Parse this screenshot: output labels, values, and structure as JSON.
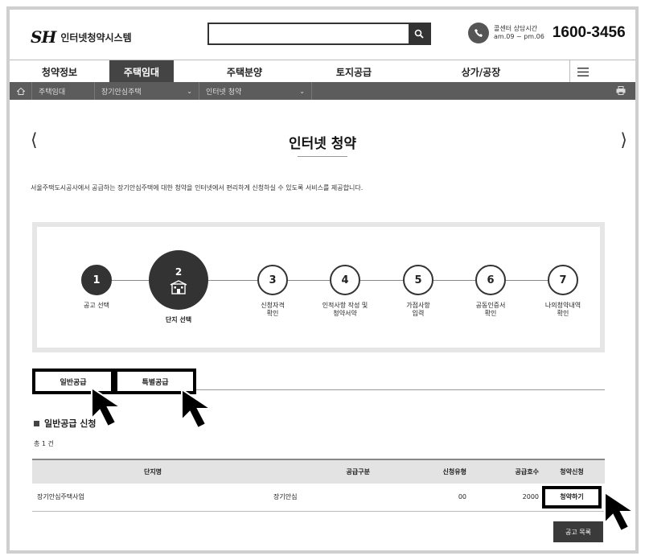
{
  "header": {
    "logo_mark": "SH",
    "logo_text": "인터넷청약시스템",
    "search": {
      "value": "",
      "placeholder": ""
    },
    "callcenter": {
      "label": "콜센터 상담시간",
      "hours": "am.09 ~ pm.06",
      "number": "1600-3456"
    }
  },
  "nav": {
    "items": [
      {
        "label": "청약정보"
      },
      {
        "label": "주택임대"
      },
      {
        "label": "주택분양"
      },
      {
        "label": "토지공급"
      },
      {
        "label": "상가/공장"
      }
    ],
    "active_index": 1
  },
  "breadcrumb": {
    "items": [
      "주택임대",
      "장기안심주택",
      "인터넷 청약"
    ]
  },
  "page": {
    "title": "인터넷 청약",
    "intro": "서울주택도시공사에서 공급하는 장기안심주택에 대한 청약을 인터넷에서 편리하게 신청하실 수 있도록 서비스를 제공합니다."
  },
  "steps": [
    {
      "num": "1",
      "label": "공고 선택"
    },
    {
      "num": "2",
      "label": "단지 선택"
    },
    {
      "num": "3",
      "label": "신청자격\n확인"
    },
    {
      "num": "4",
      "label": "인적사항 작성 및\n청약서약"
    },
    {
      "num": "5",
      "label": "가점사항\n입력"
    },
    {
      "num": "6",
      "label": "공동인증서\n확인"
    },
    {
      "num": "7",
      "label": "나의청약내역\n확인"
    }
  ],
  "tabs": [
    {
      "label": "일반공급"
    },
    {
      "label": "특별공급"
    }
  ],
  "section": {
    "title": "일반공급 신청",
    "count": "총 1 건"
  },
  "table": {
    "headers": [
      "단지명",
      "공급구분",
      "신청유형",
      "공급호수",
      "청약신청"
    ],
    "rows": [
      {
        "name": "장기안심주택사업",
        "type": "장기안심",
        "apply_type": "00",
        "units": "2000",
        "button": "청약하기"
      }
    ]
  },
  "list_button": "공고 목록",
  "colors": {
    "dark": "#333333",
    "crumbbar": "#5c5c5c",
    "header_row": "#e3e3e3"
  }
}
